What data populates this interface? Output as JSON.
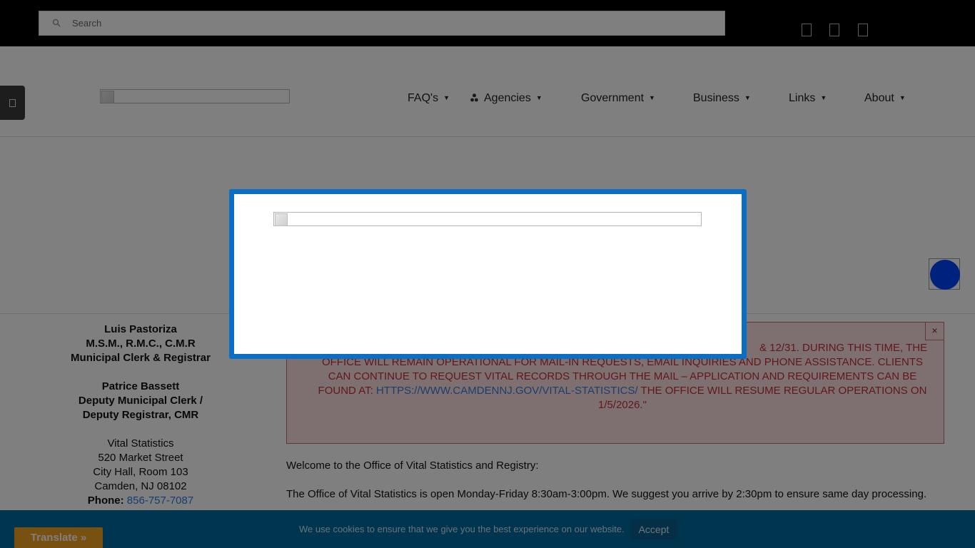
{
  "search": {
    "placeholder": "Search"
  },
  "nav": {
    "items": [
      {
        "label": "FAQ's"
      },
      {
        "label": "Agencies"
      },
      {
        "label": "Government"
      },
      {
        "label": "Business"
      },
      {
        "label": "Links"
      },
      {
        "label": "About"
      }
    ],
    "caret": "▼"
  },
  "contact": {
    "clerk_name": "Luis Pastoriza",
    "clerk_credentials": "M.S.M., R.M.C., C.M.R",
    "clerk_title": "Municipal Clerk & Registrar",
    "deputy_name": "Patrice Bassett",
    "deputy_title_1": "Deputy Municipal Clerk /",
    "deputy_title_2": "Deputy Registrar, CMR",
    "office": "Vital Statistics",
    "street": "520 Market Street",
    "room": "City Hall, Room 103",
    "city": "Camden, NJ 08102",
    "phone_label": "Phone:",
    "phone": "856-757-7087"
  },
  "alert": {
    "line1_visible": "& 12/31.  DURING THIS TIME, THE",
    "line2": "OFFICE WILL REMAIN OPERATIONAL FOR MAIL-IN REQUESTS, EMAIL INQUIRIES AND PHONE ASSISTANCE. CLIENTS CAN CONTINUE TO REQUEST VITAL RECORDS THROUGH THE MAIL – APPLICATION AND REQUIREMENTS CAN BE FOUND AT:",
    "link": "HTTPS://WWW.CAMDENNJ.GOV/VITAL-STATISTICS/",
    "tail": " THE OFFICE WILL RESUME REGULAR OPERATIONS ON 1/5/2026.\"",
    "close": "×"
  },
  "main": {
    "welcome": "Welcome to the Office of Vital Statistics and Registry:",
    "hours": "The Office of Vital Statistics is open Monday-Friday 8:30am-3:00pm. We suggest you arrive by 2:30pm to ensure same day processing."
  },
  "cookie": {
    "text": "We use cookies to ensure that we give you the best experience on our website.",
    "accept": "Accept"
  },
  "translate": {
    "label": "Translate »"
  },
  "colors": {
    "accent": "#0a6fc4",
    "alert_text": "#c0303a",
    "link": "#2a7ae2",
    "cookie_bar": "#006b9f",
    "translate": "#f0a020"
  },
  "icons": {
    "search": "search-icon",
    "social": [
      "facebook-icon",
      "twitter-icon",
      "instagram-icon"
    ],
    "side": "contrast-icon",
    "agencies": "people-icon",
    "accessibility": "accessibility-icon"
  }
}
